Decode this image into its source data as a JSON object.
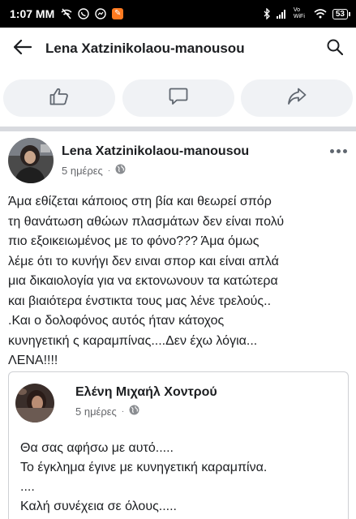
{
  "status_bar": {
    "time": "1:07 MM",
    "battery": "53",
    "network": "Vo WiFi"
  },
  "app_bar": {
    "title": "Lena Xatzinikolaou-manousou"
  },
  "icons": {
    "back": "arrow-left-icon",
    "search": "search-icon",
    "like": "thumbs-up-icon",
    "comment": "speech-bubble-icon",
    "share": "share-arrow-icon",
    "privacy": "globe-icon",
    "more": "more-dots-icon"
  },
  "post": {
    "author": "Lena Xatzinikolaou-manousou",
    "time": "5 ημέρες",
    "separator": "·",
    "text_lines": [
      "Άμα εθίζεται κάποιος στη βία και θεωρεί σπόρ",
      "τη θανάτωση αθώων πλασμάτων δεν είναι πολύ",
      "πιο εξοικειωμένος με το φόνο??? Άμα όμως",
      "λέμε ότι το κυνήγι δεν ειναι σπορ και είναι απλά",
      "μια δικαιολογία για να εκτονωνουν τα κατώτερα",
      "και βιαιότερα ένστικτα τους μας λένε τρελούς..",
      ".Και ο δολοφόνος αυτός ήταν κάτοχος",
      "κυνηγετική ς καραμπίνας....Δεν έχω λόγια...",
      "ΛΕΝΑ!!!!"
    ]
  },
  "shared_post": {
    "author": "Ελένη Μιχαήλ Χοντρού",
    "time": "5 ημέρες",
    "separator": "·",
    "text_lines": [
      "Θα σας αφήσω με αυτό.....",
      "Το έγκλημα έγινε με κυνηγετική καραμπίνα.",
      "....",
      "Καλή συνέχεια σε όλους....."
    ]
  },
  "colors": {
    "accent": "#1c1e21",
    "muted": "#65676b",
    "button_bg": "#f0f2f5",
    "separator": "#d8dadf"
  }
}
